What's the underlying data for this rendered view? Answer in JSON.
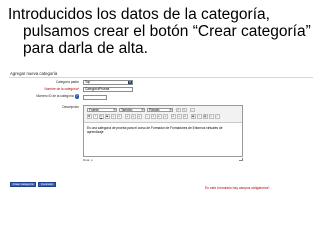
{
  "slide": {
    "line1": "Introducidos los datos de la categoría,",
    "line2": "pulsamos crear el botón “Crear categoría”",
    "line3": "para  darla de alta."
  },
  "form": {
    "heading": "Agregar nueva categoría",
    "parent_label": "Categoría padre",
    "parent_value": "Top",
    "name_label": "Nombre de la categoría",
    "name_value": "CategoríaPrueba",
    "id_label": "Número ID de la categoría",
    "id_value": "",
    "description_label": "Descripción",
    "required_star": "*"
  },
  "editor": {
    "font_value": "Fuente",
    "size_value": "Tamaño",
    "paragraph_value": "Párrafo",
    "content": "Es una categoría de prueba para el curso de Formador de Formadores de Entornos virtuales de aprendizaje",
    "path_label": "Ruta: p"
  },
  "buttons": {
    "create": "Crear categoría",
    "cancel": "Cancelar"
  },
  "footer_note": "En este formulario hay campos obligatorios*",
  "colors": {
    "button_bg": "#3b62b4",
    "required": "#b00000"
  }
}
